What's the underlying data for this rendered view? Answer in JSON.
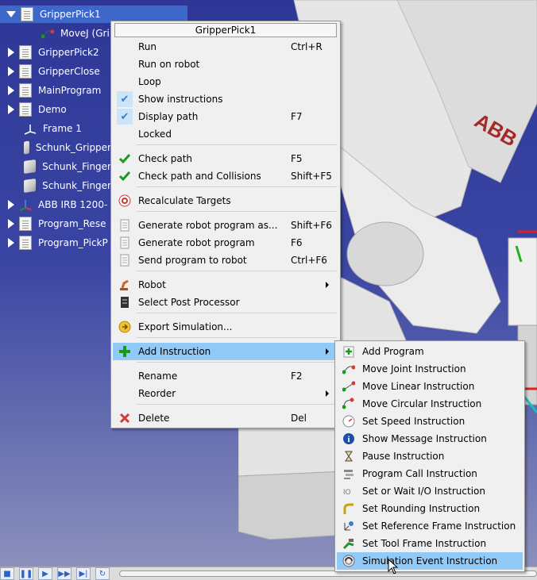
{
  "tree": {
    "items": [
      {
        "label": "GripperPick1",
        "icon": "document-icon",
        "expander": "expanded",
        "selected": true
      },
      {
        "label": "MoveJ (Gri",
        "icon": "move-joint-icon",
        "expander": "none"
      },
      {
        "label": "GripperPick2",
        "icon": "document-icon",
        "expander": "collapsed"
      },
      {
        "label": "GripperClose",
        "icon": "document-icon",
        "expander": "collapsed"
      },
      {
        "label": "MainProgram",
        "icon": "document-icon",
        "expander": "collapsed"
      },
      {
        "label": "Demo",
        "icon": "document-icon",
        "expander": "collapsed"
      },
      {
        "label": "Frame 1",
        "icon": "frame-icon",
        "expander": "none"
      },
      {
        "label": "Schunk_Gripper",
        "icon": "cube-icon",
        "expander": "none"
      },
      {
        "label": "Schunk_Finger",
        "icon": "cube-icon",
        "expander": "none"
      },
      {
        "label": "Schunk_Finger",
        "icon": "cube-icon",
        "expander": "none"
      },
      {
        "label": "ABB IRB 1200-",
        "icon": "robot-frame-icon",
        "expander": "collapsed"
      },
      {
        "label": "Program_Rese",
        "icon": "document-icon",
        "expander": "collapsed"
      },
      {
        "label": "Program_PickP",
        "icon": "document-icon",
        "expander": "collapsed"
      }
    ]
  },
  "context_menu": {
    "title": "GripperPick1",
    "items": [
      {
        "label": "Run",
        "shortcut": "Ctrl+R"
      },
      {
        "label": "Run on robot",
        "shortcut": ""
      },
      {
        "label": "Loop",
        "shortcut": ""
      },
      {
        "label": "Show instructions",
        "shortcut": "",
        "checked": true
      },
      {
        "label": "Display path",
        "shortcut": "F7",
        "checked": true
      },
      {
        "label": "Locked",
        "shortcut": ""
      },
      {
        "label": "Check path",
        "shortcut": "F5",
        "icon": "green-check-icon"
      },
      {
        "label": "Check path and Collisions",
        "shortcut": "Shift+F5",
        "icon": "green-check-icon"
      },
      {
        "label": "Recalculate Targets",
        "shortcut": "",
        "icon": "target-icon"
      },
      {
        "label": "Generate robot program as...",
        "shortcut": "Shift+F6",
        "icon": "program-file-icon"
      },
      {
        "label": "Generate robot program",
        "shortcut": "F6",
        "icon": "program-file-icon"
      },
      {
        "label": "Send program to robot",
        "shortcut": "Ctrl+F6",
        "icon": "program-file-icon"
      },
      {
        "label": "Robot",
        "shortcut": "",
        "icon": "robot-arm-icon",
        "submenu": true
      },
      {
        "label": "Select Post Processor",
        "shortcut": "",
        "icon": "post-processor-icon"
      },
      {
        "label": "Export Simulation...",
        "shortcut": "",
        "icon": "export-simulation-icon"
      },
      {
        "label": "Add Instruction",
        "shortcut": "",
        "icon": "green-plus-icon",
        "submenu": true,
        "highlighted": true
      },
      {
        "label": "Rename",
        "shortcut": "F2"
      },
      {
        "label": "Reorder",
        "shortcut": "",
        "submenu": true
      },
      {
        "label": "Delete",
        "shortcut": "Del",
        "icon": "red-x-icon"
      }
    ]
  },
  "add_instruction_menu": {
    "items": [
      {
        "label": "Add Program",
        "icon": "add-program-icon"
      },
      {
        "label": "Move Joint Instruction",
        "icon": "move-joint-icon"
      },
      {
        "label": "Move Linear Instruction",
        "icon": "move-linear-icon"
      },
      {
        "label": "Move Circular Instruction",
        "icon": "move-circular-icon"
      },
      {
        "label": "Set Speed Instruction",
        "icon": "speed-gauge-icon"
      },
      {
        "label": "Show Message Instruction",
        "icon": "info-icon"
      },
      {
        "label": "Pause Instruction",
        "icon": "hourglass-icon"
      },
      {
        "label": "Program Call Instruction",
        "icon": "program-call-icon"
      },
      {
        "label": "Set or Wait I/O Instruction",
        "icon": "io-icon"
      },
      {
        "label": "Set Rounding Instruction",
        "icon": "rounding-icon"
      },
      {
        "label": "Set Reference Frame Instruction",
        "icon": "reference-frame-icon"
      },
      {
        "label": "Set Tool Frame Instruction",
        "icon": "tool-frame-icon"
      },
      {
        "label": "Simulation Event Instruction",
        "icon": "simulation-event-icon",
        "highlighted": true
      }
    ]
  },
  "colors": {
    "highlight": "#91c9f7",
    "selected_tree": "#3d67c9",
    "background_top": "#2e3796",
    "menu_bg": "#f0f0f0"
  }
}
